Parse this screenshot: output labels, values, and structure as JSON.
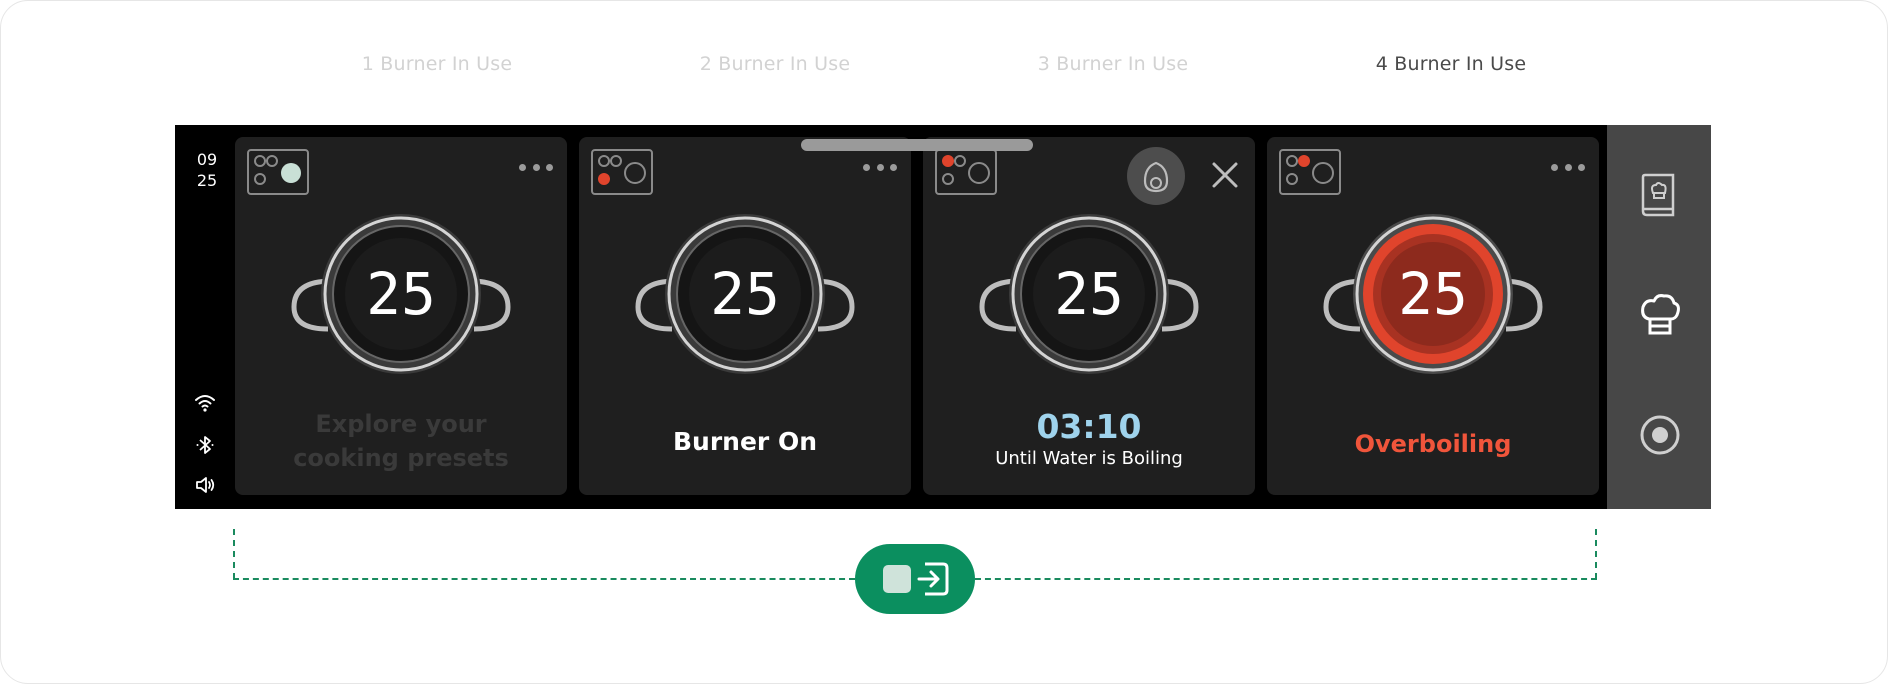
{
  "steps": [
    {
      "label": "1 Burner In Use",
      "active": false
    },
    {
      "label": "2 Burner In Use",
      "active": false
    },
    {
      "label": "3 Burner In Use",
      "active": false
    },
    {
      "label": "4 Burner In Use",
      "active": true
    }
  ],
  "status": {
    "clock_hour": "09",
    "clock_minute": "25",
    "icons": [
      "wifi-icon",
      "bluetooth-icon",
      "volume-icon"
    ]
  },
  "cards": [
    {
      "display": "25",
      "burner_active": "back-right",
      "state": "idle",
      "message_line1": "Explore your",
      "message_line2": "cooking presets",
      "menu_icon": "more-icon"
    },
    {
      "display": "25",
      "burner_active": "front-left",
      "state": "on",
      "message": "Burner On",
      "menu_icon": "more-icon"
    },
    {
      "display": "25",
      "burner_active": "back-left",
      "state": "timer",
      "timer": "03:10",
      "timer_caption": "Until Water is Boiling",
      "action_icons": [
        "egg-icon",
        "close-icon"
      ]
    },
    {
      "display": "25",
      "burner_active": "back-right",
      "state": "overboiling",
      "message": "Overboiling",
      "menu_icon": "more-icon"
    }
  ],
  "side_panel": {
    "icons": [
      "recipe-book-icon",
      "chef-hat-icon",
      "record-icon"
    ]
  },
  "bottom_action": {
    "icon": "screen-input-icon"
  },
  "colors": {
    "accent_green": "#0b8f5f",
    "burner_active_red": "#e0442c",
    "overboil_text": "#f0553b",
    "timer_blue": "#9fd3ec",
    "idle_burner_mint": "#c9e0d6",
    "card_bg": "#1f1f1f",
    "side_panel_bg": "#474747"
  }
}
